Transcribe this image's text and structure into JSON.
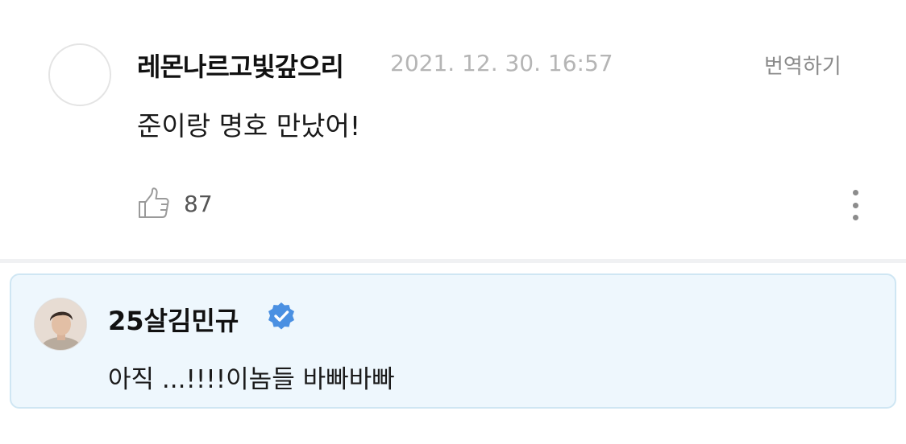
{
  "comment": {
    "author": "레몬나르고빛갚으리",
    "timestamp": "2021. 12. 30. 16:57",
    "translate_label": "번역하기",
    "text": "준이랑 명호 만났어!",
    "like_count": "87",
    "icons": {
      "like": "thumbs-up-icon",
      "more": "more-vertical-icon",
      "avatar": "empty-avatar"
    }
  },
  "reply": {
    "author": "25살김민규",
    "text": "아직 ...!!!!이놈들 바빠바빠",
    "verified": true,
    "icons": {
      "verified": "verified-badge-icon",
      "avatar": "profile-photo"
    }
  },
  "colors": {
    "verified_badge": "#4a90e2",
    "reply_background": "#eef7fd",
    "reply_border": "#cfe6f3",
    "timestamp": "#b5b5b5"
  }
}
